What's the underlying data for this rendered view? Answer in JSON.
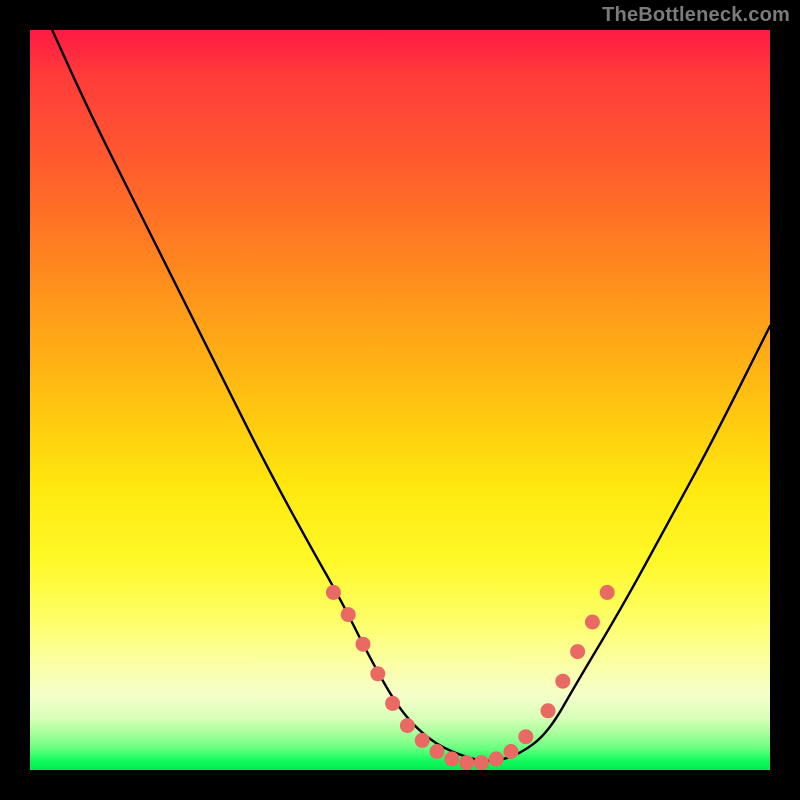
{
  "watermark": "TheBottleneck.com",
  "colors": {
    "background": "#000000",
    "curve": "#000000",
    "marker": "#e96a62",
    "watermark": "#7b7b7b"
  },
  "chart_data": {
    "type": "line",
    "title": "",
    "xlabel": "",
    "ylabel": "",
    "xlim": [
      0,
      100
    ],
    "ylim": [
      0,
      100
    ],
    "grid": false,
    "legend": null,
    "series": [
      {
        "name": "curve",
        "x": [
          3,
          8,
          14,
          20,
          26,
          32,
          38,
          42,
          46,
          50,
          54,
          58,
          62,
          66,
          70,
          74,
          80,
          86,
          92,
          100
        ],
        "y": [
          100,
          89,
          77,
          65,
          53,
          41,
          30,
          23,
          15,
          8,
          4,
          2,
          1,
          2,
          5,
          12,
          22,
          33,
          44,
          60
        ]
      }
    ],
    "markers": {
      "name": "highlight-dots",
      "color": "#e96a62",
      "points": [
        {
          "x": 41,
          "y": 24
        },
        {
          "x": 43,
          "y": 21
        },
        {
          "x": 45,
          "y": 17
        },
        {
          "x": 47,
          "y": 13
        },
        {
          "x": 49,
          "y": 9
        },
        {
          "x": 51,
          "y": 6
        },
        {
          "x": 53,
          "y": 4
        },
        {
          "x": 55,
          "y": 2.5
        },
        {
          "x": 57,
          "y": 1.5
        },
        {
          "x": 59,
          "y": 1
        },
        {
          "x": 61,
          "y": 1
        },
        {
          "x": 63,
          "y": 1.5
        },
        {
          "x": 65,
          "y": 2.5
        },
        {
          "x": 67,
          "y": 4.5
        },
        {
          "x": 70,
          "y": 8
        },
        {
          "x": 72,
          "y": 12
        },
        {
          "x": 74,
          "y": 16
        },
        {
          "x": 76,
          "y": 20
        },
        {
          "x": 78,
          "y": 24
        }
      ]
    }
  }
}
